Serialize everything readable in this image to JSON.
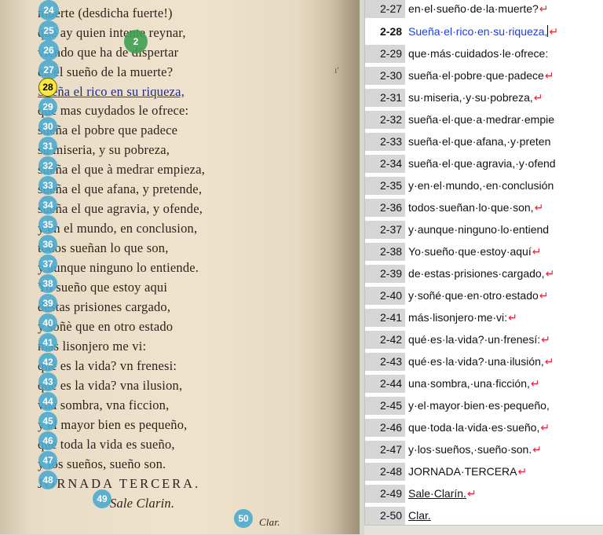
{
  "scan": {
    "lines": [
      {
        "num": "24",
        "text": "muerte (desdicha fuerte!)"
      },
      {
        "num": "25",
        "text": "que ay quien intente reynar,"
      },
      {
        "num": "26",
        "text": "viendo que ha de dispertar"
      },
      {
        "num": "27",
        "text": "en el sueño de la muerte?"
      },
      {
        "num": "28",
        "text": "Sueña el rico en su riqueza,"
      },
      {
        "num": "29",
        "text": "que mas cuydados le ofrece:"
      },
      {
        "num": "30",
        "text": "sueña el pobre que padece"
      },
      {
        "num": "31",
        "text": "su miseria, y su pobreza,"
      },
      {
        "num": "32",
        "text": "sueña el que à medrar empieza,"
      },
      {
        "num": "33",
        "text": "sueña el que afana, y pretende,"
      },
      {
        "num": "34",
        "text": "sueña el que agravia, y ofende,"
      },
      {
        "num": "35",
        "text": "y en el mundo, en conclusion,"
      },
      {
        "num": "36",
        "text": "todos sueñan lo que son,"
      },
      {
        "num": "37",
        "text": "y aunque ninguno lo entiende."
      },
      {
        "num": "38",
        "text": "Yo sueño que estoy aqui"
      },
      {
        "num": "39",
        "text": "destas prisiones cargado,"
      },
      {
        "num": "40",
        "text": "y soñè que en otro estado"
      },
      {
        "num": "41",
        "text": "mas lisonjero me vi:"
      },
      {
        "num": "42",
        "text": "què es la vida? vn frenesi:"
      },
      {
        "num": "43",
        "text": "què es la vida? vna ilusion,"
      },
      {
        "num": "44",
        "text": "vna sombra, vna ficcion,"
      },
      {
        "num": "45",
        "text": "y el mayor bien es pequeño,"
      },
      {
        "num": "46",
        "text": "que toda la vida es sueño,"
      },
      {
        "num": "47",
        "text": "y los sueños, sueño son."
      },
      {
        "num": "48",
        "text": "JORNADA TERCERA."
      },
      {
        "num": "49",
        "text": "Sale Clarin."
      },
      {
        "num": "50",
        "text": "Clar."
      }
    ],
    "extra_marker": "2"
  },
  "editor": {
    "rows": [
      {
        "num": "2-27",
        "text": "en·el·sueño·de·la·muerte?"
      },
      {
        "num": "2-28",
        "text": "Sueña·el·rico·en·su·riqueza,"
      },
      {
        "num": "2-29",
        "text": "que·más·cuidados·le·ofrece:"
      },
      {
        "num": "2-30",
        "text": "sueña·el·pobre·que·padece"
      },
      {
        "num": "2-31",
        "text": "su·miseria,·y·su·pobreza,"
      },
      {
        "num": "2-32",
        "text": "sueña·el·que·a·medrar·empie"
      },
      {
        "num": "2-33",
        "text": "sueña·el·que·afana,·y·preten"
      },
      {
        "num": "2-34",
        "text": "sueña·el·que·agravia,·y·ofend"
      },
      {
        "num": "2-35",
        "text": "y·en·el·mundo,·en·conclusión"
      },
      {
        "num": "2-36",
        "text": "todos·sueñan·lo·que·son,"
      },
      {
        "num": "2-37",
        "text": "y·aunque·ninguno·lo·entiend"
      },
      {
        "num": "2-38",
        "text": "Yo·sueño·que·estoy·aquí"
      },
      {
        "num": "2-39",
        "text": "de·estas·prisiones·cargado,"
      },
      {
        "num": "2-40",
        "text": "y·soñé·que·en·otro·estado"
      },
      {
        "num": "2-41",
        "text": "más·lisonjero·me·vi:"
      },
      {
        "num": "2-42",
        "text": "qué·es·la·vida?·un·frenesí:"
      },
      {
        "num": "2-43",
        "text": "qué·es·la·vida?·una·ilusión,"
      },
      {
        "num": "2-44",
        "text": "una·sombra,·una·ficción,"
      },
      {
        "num": "2-45",
        "text": "y·el·mayor·bien·es·pequeño,"
      },
      {
        "num": "2-46",
        "text": "que·toda·la·vida·es·sueño,"
      },
      {
        "num": "2-47",
        "text": "y·los·sueños,·sueño·son."
      },
      {
        "num": "2-48",
        "text": "JORNADA·TERCERA"
      },
      {
        "num": "2-49",
        "text": "Sale·Clarín."
      },
      {
        "num": "2-50",
        "text": "Clar."
      }
    ],
    "pilcrow": "↵",
    "accent_color": "#1d3ed8",
    "pilcrow_color": "#e0243a",
    "highlight_color": "#fbe93a",
    "marker_color": "#4caacd"
  }
}
